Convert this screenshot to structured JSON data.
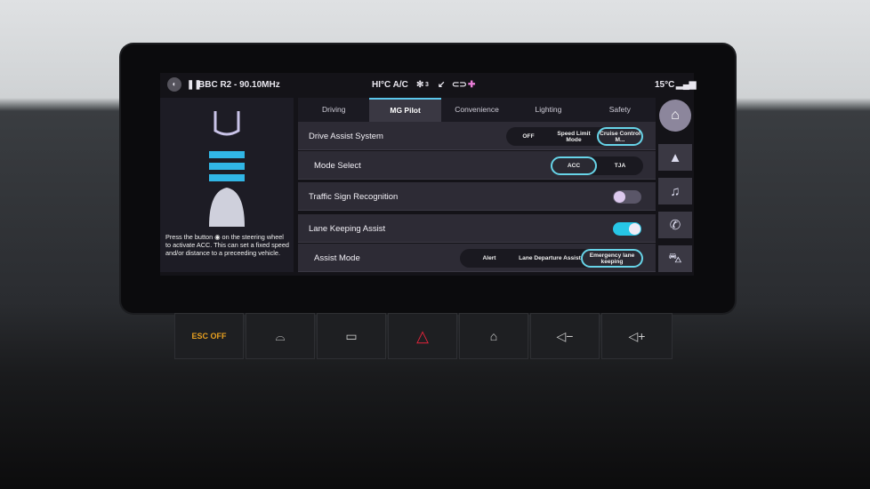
{
  "status": {
    "radio": "BBC R2 - 90.10MHz",
    "climate": "HI°C A/C",
    "fan": "3",
    "temperature": "15°C"
  },
  "tabs": [
    {
      "label": "Driving"
    },
    {
      "label": "MG Pilot",
      "active": true
    },
    {
      "label": "Convenience"
    },
    {
      "label": "Lighting"
    },
    {
      "label": "Safety"
    }
  ],
  "hint": "Press the button ◉ on the steering wheel to activate ACC. This can set a fixed speed and/or distance to a preceeding vehicle.",
  "rows": {
    "drive_assist": {
      "label": "Drive Assist System",
      "options": [
        "OFF",
        "Speed Limit Mode",
        "Cruise Control M..."
      ],
      "selected": "Cruise Control M..."
    },
    "mode_select": {
      "label": "Mode Select",
      "options": [
        "ACC",
        "TJA"
      ],
      "selected": "ACC"
    },
    "traffic_sign": {
      "label": "Traffic Sign Recognition",
      "on": false
    },
    "lane_keeping": {
      "label": "Lane Keeping Assist",
      "on": true
    },
    "assist_mode": {
      "label": "Assist Mode",
      "options": [
        "Alert",
        "Lane Departure Assist",
        "Emergency lane keeping"
      ],
      "selected": "Emergency lane keeping"
    }
  },
  "sidebar": [
    "home-icon",
    "navigation-icon",
    "music-icon",
    "phone-icon",
    "car-icon"
  ],
  "physical_buttons": [
    "ESC OFF",
    "front-defrost",
    "rear-defrost",
    "hazard",
    "home",
    "volume-down",
    "volume-up"
  ],
  "colors": {
    "accent": "#5cc7ec",
    "toggle_on": "#27c6e6",
    "hazard": "#e0243a"
  }
}
